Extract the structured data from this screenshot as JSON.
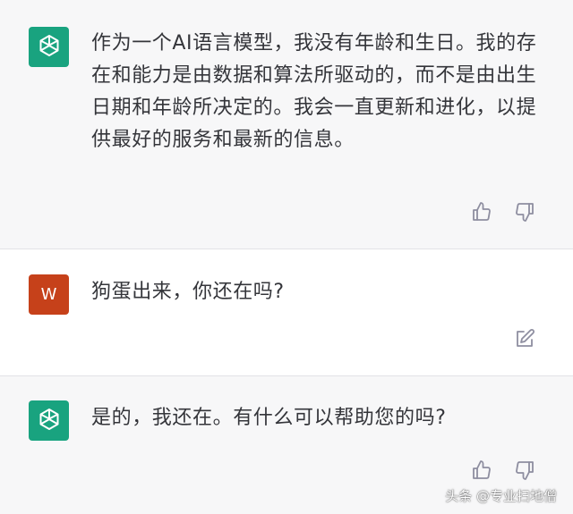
{
  "colors": {
    "assistant_bg": "#f7f7f8",
    "gpt_avatar": "#19a37f",
    "user_avatar": "#c6411a",
    "icon_gray": "#8e8ea0"
  },
  "messages": [
    {
      "role": "assistant",
      "avatar_icon": "openai-logo-icon",
      "text": "作为一个AI语言模型，我没有年龄和生日。我的存在和能力是由数据和算法所驱动的，而不是由出生日期和年龄所决定的。我会一直更新和进化，以提供最好的服务和最新的信息。"
    },
    {
      "role": "user",
      "avatar_letter": "W",
      "text": "狗蛋出来，你还在吗?"
    },
    {
      "role": "assistant",
      "avatar_icon": "openai-logo-icon",
      "text": "是的，我还在。有什么可以帮助您的吗?"
    }
  ],
  "watermark": "头条 @专业扫地僧"
}
